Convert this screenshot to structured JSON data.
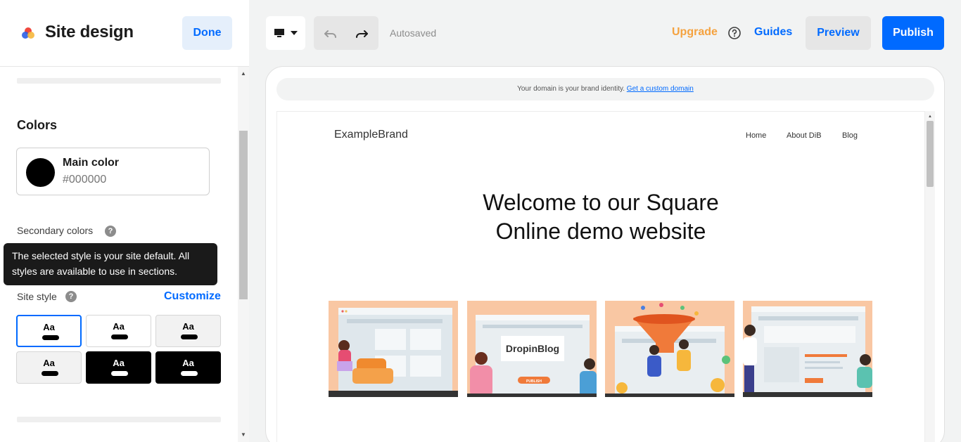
{
  "sidebar": {
    "title": "Site design",
    "done_label": "Done",
    "colors_heading": "Colors",
    "main_color": {
      "label": "Main color",
      "hex": "#000000"
    },
    "secondary_colors_label": "Secondary colors",
    "tooltip_text": "The selected style is your site default. All styles are available to use in sections.",
    "site_style_label": "Site style",
    "customize_label": "Customize",
    "style_tiles": [
      {
        "label": "Aa",
        "theme": "white",
        "selected": true
      },
      {
        "label": "Aa",
        "theme": "white",
        "selected": false
      },
      {
        "label": "Aa",
        "theme": "grey",
        "selected": false
      },
      {
        "label": "Aa",
        "theme": "grey",
        "selected": false
      },
      {
        "label": "Aa",
        "theme": "black",
        "selected": false
      },
      {
        "label": "Aa",
        "theme": "black",
        "selected": false
      }
    ]
  },
  "toolbar": {
    "device_icon": "desktop-icon",
    "autosaved": "Autosaved",
    "upgrade": "Upgrade",
    "guides": "Guides",
    "preview": "Preview",
    "publish": "Publish"
  },
  "preview": {
    "domain_text": "Your domain is your brand identity.",
    "domain_link": "Get a custom domain",
    "brand": "ExampleBrand",
    "nav": [
      "Home",
      "About DiB",
      "Blog"
    ],
    "hero_line1": "Welcome to our Square",
    "hero_line2": "Online demo website",
    "dropinblog_logo": "DropinBlog",
    "dropinblog_button": "PUBLISH"
  },
  "colors": {
    "accent": "#006aff",
    "upgrade": "#f5a23f",
    "illustration_peach": "#f9c7a3"
  }
}
